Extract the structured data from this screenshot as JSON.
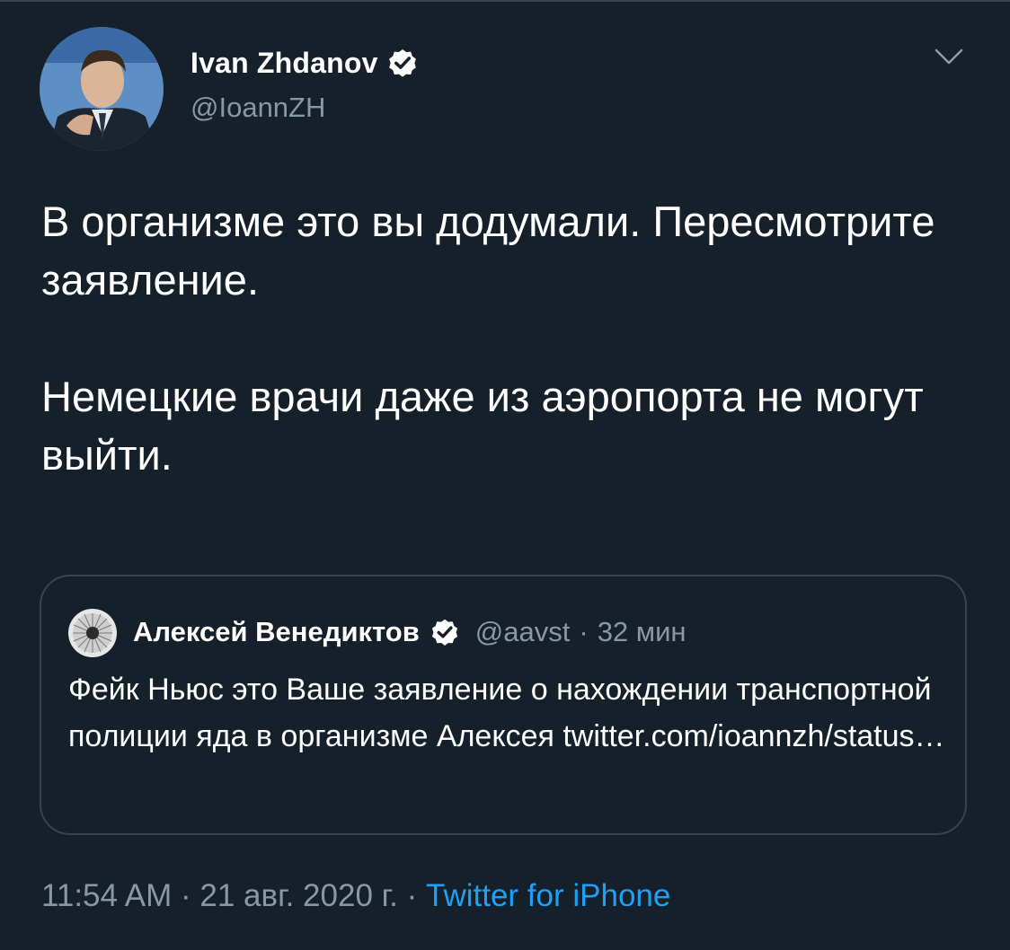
{
  "author": {
    "display_name": "Ivan Zhdanov",
    "handle": "@IoannZH",
    "verified": true
  },
  "tweet": {
    "paragraphs": [
      "В организме это вы додумали. Пересмотрите заявление.",
      "Немецкие врачи даже из аэропорта не могут выйти."
    ]
  },
  "quoted_tweet": {
    "display_name": "Алексей Венедиктов",
    "handle": "@aavst",
    "separator": "·",
    "time_ago": "32 мин",
    "text": "Фейк Ньюс это Ваше заявление о нахождении транспортной полиции яда в организме Алексея twitter.com/ioannzh/status…",
    "verified": true
  },
  "footer": {
    "time": "11:54 AM",
    "sep1": "·",
    "date": "21 авг. 2020 г.",
    "sep2": "·",
    "source": "Twitter for iPhone"
  },
  "colors": {
    "background": "#15202b",
    "border": "#38444d",
    "secondary_text": "#8899a6",
    "link": "#1da1f2",
    "verified": "#ffffff"
  },
  "icons": {
    "verified": "verified-badge-icon",
    "caret": "chevron-down-icon"
  }
}
